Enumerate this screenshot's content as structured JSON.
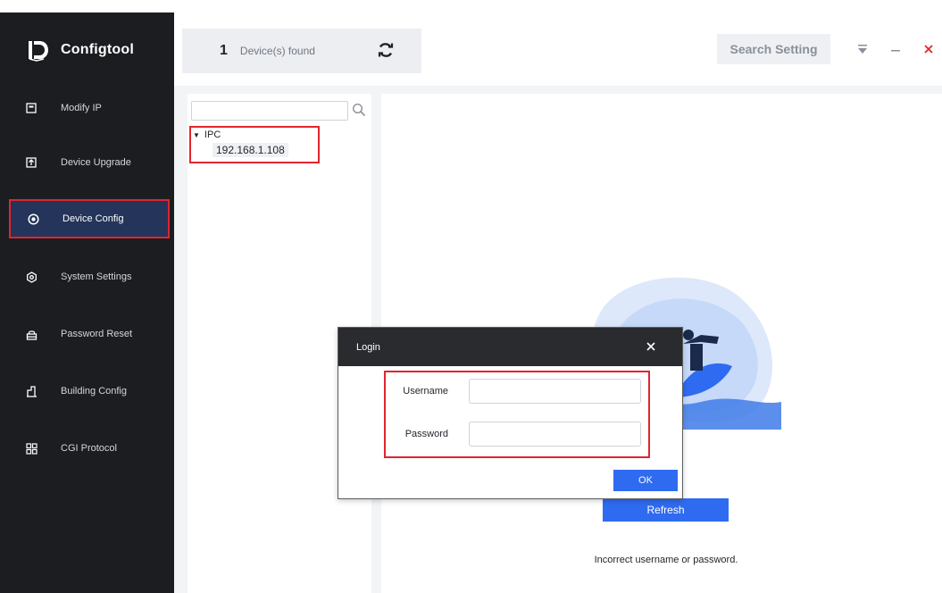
{
  "app": {
    "title": "Configtool",
    "logo_icon": "configtool-logo-icon"
  },
  "sidebar": {
    "items": [
      {
        "label": "Modify IP",
        "icon": "modify-ip-icon"
      },
      {
        "label": "Device Upgrade",
        "icon": "device-upgrade-icon"
      },
      {
        "label": "Device Config",
        "icon": "device-config-icon",
        "active": true
      },
      {
        "label": "System Settings",
        "icon": "system-settings-icon"
      },
      {
        "label": "Password Reset",
        "icon": "password-reset-icon"
      },
      {
        "label": "Building Config",
        "icon": "building-config-icon"
      },
      {
        "label": "CGI Protocol",
        "icon": "cgi-protocol-icon"
      }
    ]
  },
  "header": {
    "device_count": "1",
    "device_count_label": "Device(s) found",
    "search_setting_label": "Search Setting"
  },
  "tree": {
    "search_placeholder": "",
    "group_label": "IPC",
    "devices": [
      "192.168.1.108"
    ]
  },
  "content": {
    "refresh_label": "Refresh",
    "error_message": "Incorrect username or password."
  },
  "login_dialog": {
    "title": "Login",
    "username_label": "Username",
    "username_value": "",
    "password_label": "Password",
    "password_value": "",
    "ok_label": "OK"
  },
  "colors": {
    "sidebar_bg": "#1b1d20",
    "active_item_bg": "#24345a",
    "highlight_red": "#e0252f",
    "accent_blue": "#2f6bf0",
    "close_red": "#e0252f"
  }
}
